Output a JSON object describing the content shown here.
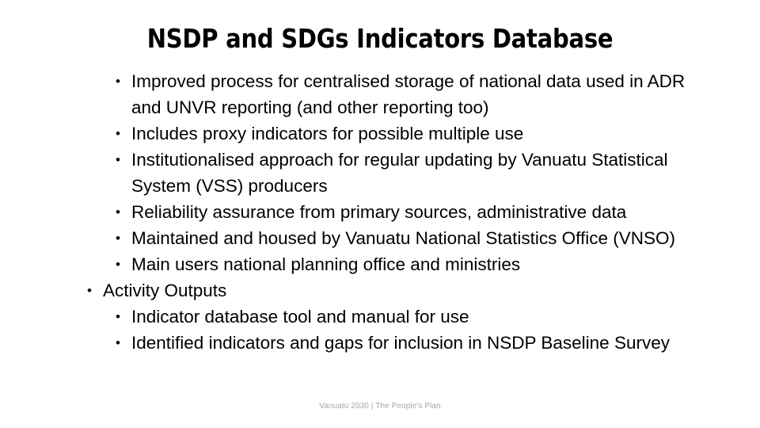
{
  "slide": {
    "title": "NSDP and SDGs Indicators Database",
    "background_color": "#ffffff",
    "text_color": "#000000",
    "bullet_glyph": "•",
    "lines": [
      {
        "level": 1,
        "has_bullet": true,
        "text": "Improved process for centralised storage of national data used in ADR"
      },
      {
        "level": 1,
        "has_bullet": false,
        "text": "and UNVR reporting (and other reporting too)"
      },
      {
        "level": 1,
        "has_bullet": true,
        "text": "Includes proxy indicators for possible multiple use"
      },
      {
        "level": 1,
        "has_bullet": true,
        "text": "Institutionalised approach for regular updating by Vanuatu Statistical"
      },
      {
        "level": 1,
        "has_bullet": false,
        "text": "System (VSS) producers"
      },
      {
        "level": 1,
        "has_bullet": true,
        "text": "Reliability assurance from primary sources, administrative data"
      },
      {
        "level": 1,
        "has_bullet": true,
        "text": "Maintained and housed by Vanuatu National Statistics Office (VNSO)"
      },
      {
        "level": 1,
        "has_bullet": true,
        "text": "Main users national planning office and ministries"
      },
      {
        "level": 0,
        "has_bullet": true,
        "text": "Activity Outputs"
      },
      {
        "level": 2,
        "has_bullet": true,
        "text": "Indicator database tool and manual for use"
      },
      {
        "level": 2,
        "has_bullet": true,
        "text": "Identified indicators and gaps for inclusion in NSDP Baseline Survey"
      }
    ],
    "footer": {
      "text": "Vanuatu 2030 | The People's Plan",
      "color": "#a6a6a6"
    }
  }
}
